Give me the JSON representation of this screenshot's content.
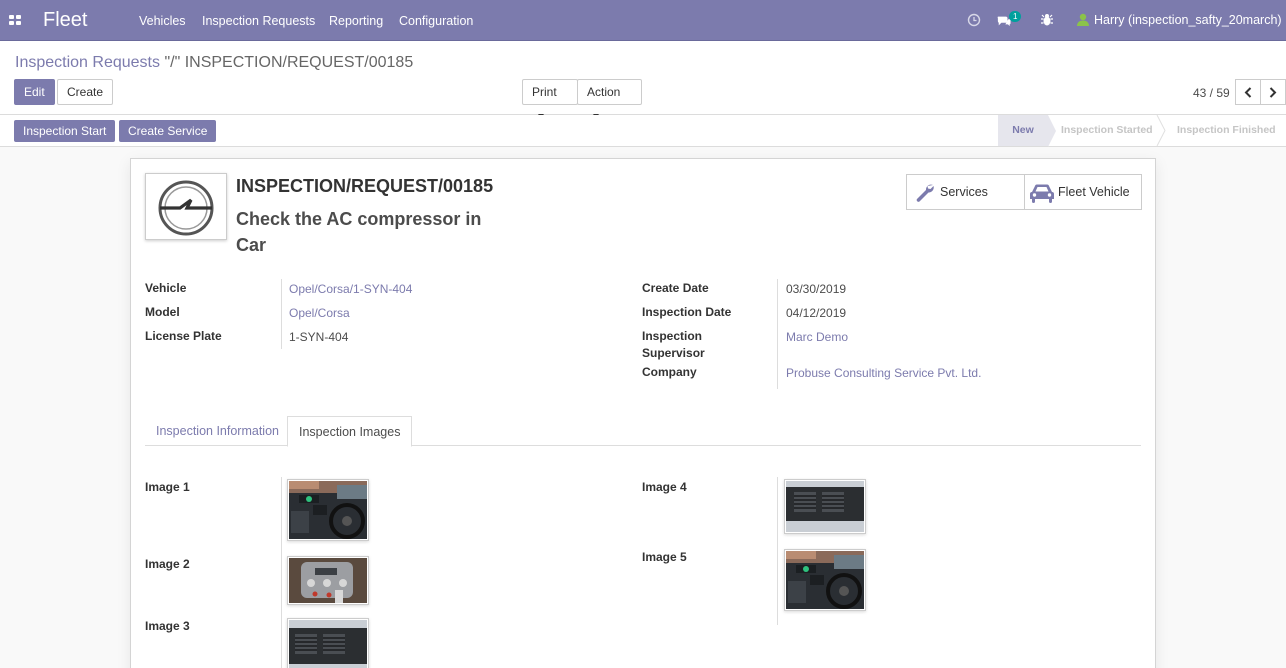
{
  "navbar": {
    "brand": "Fleet",
    "menus": [
      "Vehicles",
      "Inspection Requests",
      "Reporting",
      "Configuration"
    ],
    "messages_count": "1",
    "user": "Harry (inspection_safty_20march)",
    "color": "#7c7bad"
  },
  "breadcrumb": {
    "parent": "Inspection Requests",
    "separator": "\"/\"",
    "current": "INSPECTION/REQUEST/00185"
  },
  "buttons": {
    "edit": "Edit",
    "create": "Create",
    "print": "Print",
    "action": "Action"
  },
  "pager": {
    "value": "43 / 59"
  },
  "statusbar": {
    "buttons": [
      "Inspection Start",
      "Create Service"
    ],
    "stages": [
      "New",
      "Inspection Started",
      "Inspection Finished"
    ],
    "active_stage": "New"
  },
  "record": {
    "reference": "INSPECTION/REQUEST/00185",
    "subject_line1": "Check the AC compressor in",
    "subject_line2": "Car",
    "smart_buttons": {
      "services": "Services",
      "fleet_vehicle": "Fleet Vehicle"
    },
    "left_fields": [
      {
        "label": "Vehicle",
        "value": "Opel/Corsa/1-SYN-404"
      },
      {
        "label": "Model",
        "value": "Opel/Corsa"
      },
      {
        "label": "License Plate",
        "value": "1-SYN-404"
      }
    ],
    "right_fields": [
      {
        "label": "Create Date",
        "value": "03/30/2019"
      },
      {
        "label": "Inspection Date",
        "value": "04/12/2019"
      },
      {
        "label_line1": "Inspection",
        "label_line2": "Supervisor",
        "value": "Marc Demo"
      },
      {
        "label": "Company",
        "value": "Probuse Consulting Service Pvt. Ltd."
      }
    ],
    "tabs": [
      "Inspection Information",
      "Inspection Images"
    ],
    "active_tab": "Inspection Images",
    "images": [
      "Image 1",
      "Image 2",
      "Image 3",
      "Image 4",
      "Image 5"
    ]
  }
}
